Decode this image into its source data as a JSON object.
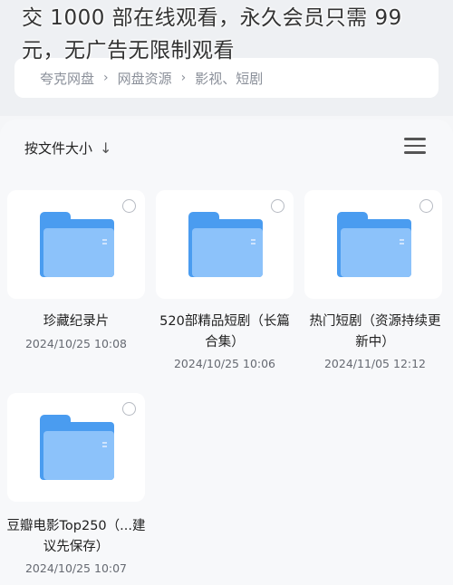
{
  "breadcrumb": {
    "items": [
      "夸克网盘",
      "网盘资源",
      "影视、短剧"
    ],
    "separator": "›"
  },
  "overlay": {
    "text": "交 1000 部在线观看，永久会员只需 99 元，无广告无限制观看"
  },
  "toolbar": {
    "sort_label": "按文件大小",
    "sort_arrow": "↓",
    "view_icon": "list-view-icon"
  },
  "files": [
    {
      "name": "珍藏纪录片",
      "date": "2024/10/25 10:08"
    },
    {
      "name": "520部精品短剧（长篇合集）",
      "date": "2024/10/25 10:06"
    },
    {
      "name": "热门短剧（资源持续更新中）",
      "date": "2024/11/05 12:12"
    },
    {
      "name": "豆瓣电影Top250（...建议先保存）",
      "date": "2024/10/25 10:07"
    }
  ],
  "colors": {
    "folder_back": "#4a9cf0",
    "folder_front": "#8cc2fa",
    "background": "#f5f6f8"
  }
}
